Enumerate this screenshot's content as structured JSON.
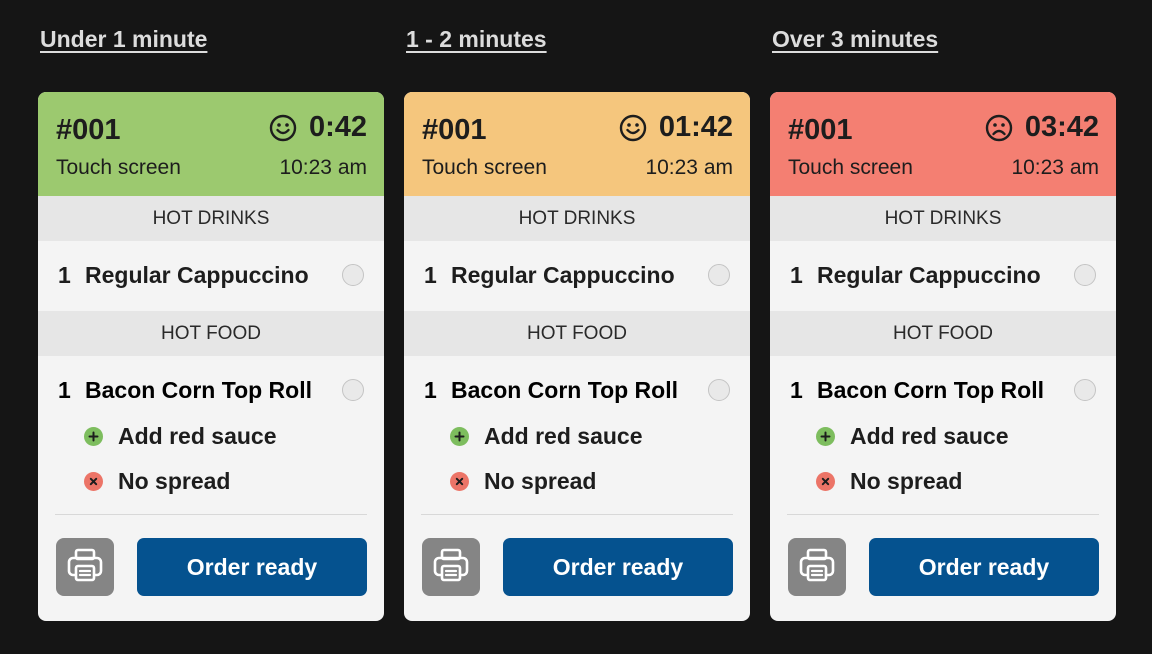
{
  "colors": {
    "background": "#151515",
    "under_1_minute": "#9cc96f",
    "one_to_two_minutes": "#f5c67d",
    "over_3_minutes": "#f47f72",
    "order_ready_button": "#05528f",
    "print_button": "#858585",
    "add_modifier": "#7dbd5e",
    "remove_modifier": "#ec7467"
  },
  "columns": [
    {
      "heading": "Under 1 minute",
      "header_color": "#9cc96f",
      "mood_icon": "smiley-face-icon",
      "order": {
        "number": "#001",
        "source": "Touch screen",
        "elapsed": "0:42",
        "time": "10:23 am",
        "categories": [
          {
            "name": "HOT DRINKS",
            "items": [
              {
                "qty": "1",
                "name": "Regular Cappuccino",
                "modifiers": []
              }
            ]
          },
          {
            "name": "HOT FOOD",
            "items": [
              {
                "qty": "1",
                "name": "Bacon Corn Top Roll",
                "modifiers": [
                  {
                    "type": "add",
                    "icon": "plus-icon",
                    "label": "Add red sauce"
                  },
                  {
                    "type": "remove",
                    "icon": "x-icon",
                    "label": "No spread"
                  }
                ]
              }
            ]
          }
        ],
        "print_icon": "printer-icon",
        "ready_label": "Order ready"
      }
    },
    {
      "heading": "1 - 2 minutes",
      "header_color": "#f5c67d",
      "mood_icon": "smiley-face-icon",
      "order": {
        "number": "#001",
        "source": "Touch screen",
        "elapsed": "01:42",
        "time": "10:23 am",
        "categories": [
          {
            "name": "HOT DRINKS",
            "items": [
              {
                "qty": "1",
                "name": "Regular Cappuccino",
                "modifiers": []
              }
            ]
          },
          {
            "name": "HOT FOOD",
            "items": [
              {
                "qty": "1",
                "name": "Bacon Corn Top Roll",
                "modifiers": [
                  {
                    "type": "add",
                    "icon": "plus-icon",
                    "label": "Add red sauce"
                  },
                  {
                    "type": "remove",
                    "icon": "x-icon",
                    "label": "No spread"
                  }
                ]
              }
            ]
          }
        ],
        "print_icon": "printer-icon",
        "ready_label": "Order ready"
      }
    },
    {
      "heading": "Over 3 minutes",
      "header_color": "#f47f72",
      "mood_icon": "sad-face-icon",
      "order": {
        "number": "#001",
        "source": "Touch screen",
        "elapsed": "03:42",
        "time": "10:23 am",
        "categories": [
          {
            "name": "HOT DRINKS",
            "items": [
              {
                "qty": "1",
                "name": "Regular Cappuccino",
                "modifiers": []
              }
            ]
          },
          {
            "name": "HOT FOOD",
            "items": [
              {
                "qty": "1",
                "name": "Bacon Corn Top Roll",
                "modifiers": [
                  {
                    "type": "add",
                    "icon": "plus-icon",
                    "label": "Add red sauce"
                  },
                  {
                    "type": "remove",
                    "icon": "x-icon",
                    "label": "No spread"
                  }
                ]
              }
            ]
          }
        ],
        "print_icon": "printer-icon",
        "ready_label": "Order ready"
      }
    }
  ]
}
